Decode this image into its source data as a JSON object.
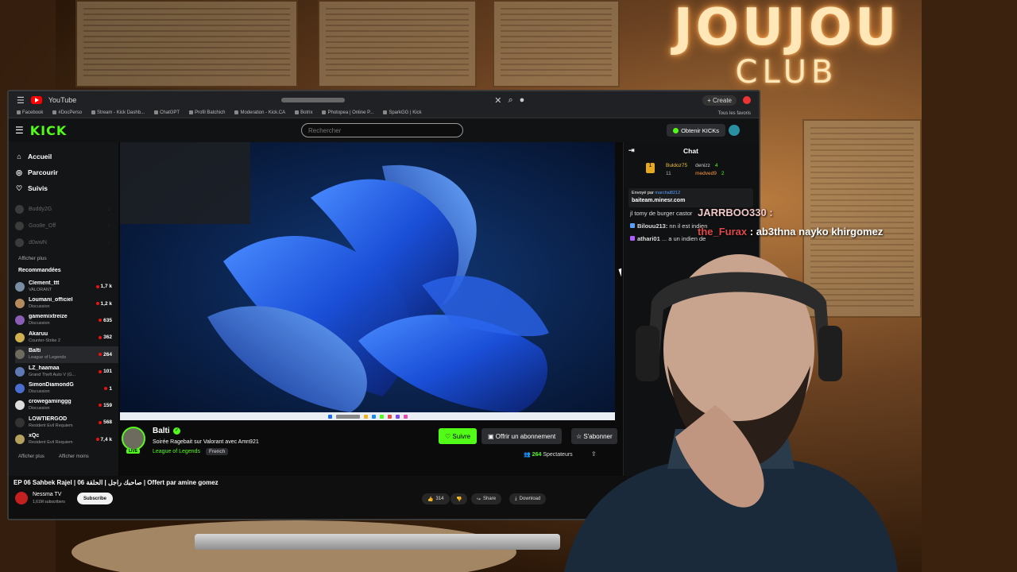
{
  "overlay": {
    "sign_line1": "JOUJOU",
    "sign_line2": "CLUB",
    "chat_user1": "JARRBOO330",
    "chat_user1_suffix": " :",
    "chat_user2": "the_Furax",
    "chat_user2_msg": " : ab3thna nayko khirgomez"
  },
  "browser": {
    "tab_title": "YouTube",
    "create_label": "+ Create",
    "bookmarks": [
      "Facebook",
      "#DocPerso",
      "Stream - Kick Dashb...",
      "ChatGPT",
      "Profil Batchich",
      "Moderation - Kick.CA",
      "Botrix",
      "Photopea | Online P...",
      "SparkGG | Kick"
    ],
    "all_bookmarks": "Tous les favoris"
  },
  "kick": {
    "logo": "KICK",
    "search_placeholder": "Rechercher",
    "get_kicks": "Obtenir KICKs",
    "nav": {
      "home": "Accueil",
      "browse": "Parcourir",
      "following": "Suivis"
    },
    "followed": [
      "Buddy2G",
      "Goo8e_Off",
      "d0wwN"
    ],
    "show_more": "Afficher plus",
    "recommended_title": "Recommandées",
    "recommended": [
      {
        "name": "Clement_ttt",
        "category": "VALORANT",
        "viewers": "1,7 k",
        "color": "#7a8ea3"
      },
      {
        "name": "Loumani_officiel",
        "category": "Discussion",
        "viewers": "1,2 k",
        "color": "#b58a5e"
      },
      {
        "name": "gamemixtreize",
        "category": "Discussion",
        "viewers": "635",
        "color": "#8a5eb5"
      },
      {
        "name": "Akaruu",
        "category": "Counter-Strike 2",
        "viewers": "362",
        "color": "#d0b050"
      },
      {
        "name": "Balti",
        "category": "League of Legends",
        "viewers": "264",
        "color": "#6d6a5e"
      },
      {
        "name": "LZ_haamaa",
        "category": "Grand Theft Auto V (G...",
        "viewers": "101",
        "color": "#5e7ab5"
      },
      {
        "name": "SimonDiamondG",
        "category": "Discussion",
        "viewers": "1",
        "color": "#4a6ed0"
      },
      {
        "name": "crowegaminggg",
        "category": "Discussion",
        "viewers": "159",
        "color": "#dddddd"
      },
      {
        "name": "LOWTIERGOD",
        "category": "Resident Evil Requiem",
        "viewers": "568",
        "color": "#333333"
      },
      {
        "name": "xQc",
        "category": "Resident Evil Requiem",
        "viewers": "7,4 k",
        "color": "#b5a05e"
      }
    ],
    "show_more_bottom": "Afficher plus",
    "show_less": "Afficher moins",
    "stream": {
      "channel": "Balti",
      "title": "Soirée Ragebait sur Valorant avec Amn921",
      "category": "League of Legends",
      "language": "French",
      "live": "LIVE",
      "follow": "Suivre",
      "gift": "Offrir un abonnement",
      "subscribe": "S'abonner",
      "viewers": "264",
      "viewers_label": "Spectateurs"
    },
    "chat": {
      "title": "Chat",
      "leaderboard": [
        {
          "user": "Buldoz75",
          "count": "11",
          "class": "gold"
        },
        {
          "user": "denizz",
          "count": "4",
          "class": "grey"
        },
        {
          "user": "medved9",
          "count": "2",
          "class": "orange"
        }
      ],
      "pinned_by": "Envoyé par",
      "pinned_user": "marchal8212",
      "pinned_msg": "baiteam.minesr.com",
      "messages": [
        {
          "user": "",
          "text": "jl tomy de burger castor"
        },
        {
          "user": "Bilouu213:",
          "text": " nn il est indien"
        },
        {
          "user": "athari01",
          "text": " ... a un indien de"
        }
      ]
    }
  },
  "youtube": {
    "video_title": "EP 06 Sahbek Rajel | صاحبك راجل | الحلقة 06 | Offert par amine gomez",
    "channel": "Nessma TV",
    "subscribers": "1,61M subscribers",
    "subscribe": "Subscribe",
    "likes": "314",
    "share": "Share",
    "download": "Download"
  }
}
